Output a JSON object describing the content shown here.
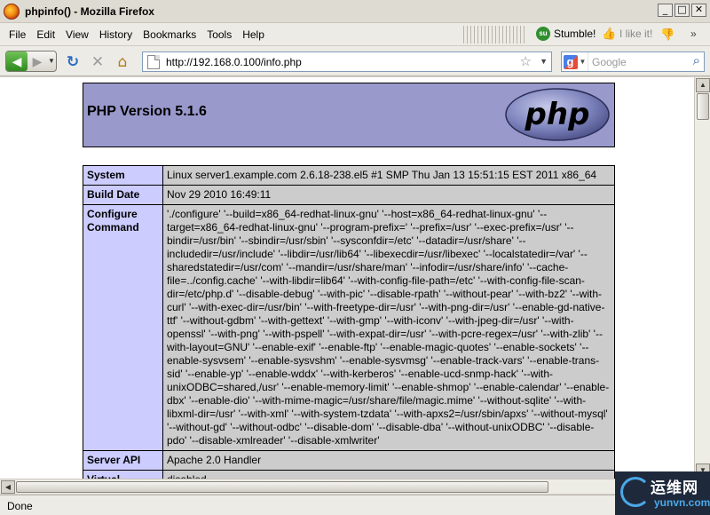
{
  "window": {
    "title": "phpinfo() - Mozilla Firefox",
    "buttons": {
      "minimize": "_",
      "maximize": "□",
      "close": "✕"
    }
  },
  "menu": {
    "items": [
      "File",
      "Edit",
      "View",
      "History",
      "Bookmarks",
      "Tools",
      "Help"
    ],
    "stumble": "Stumble!",
    "like": "I like it!"
  },
  "nav": {
    "url": "http://192.168.0.100/info.php",
    "search_placeholder": "Google"
  },
  "page": {
    "header": "PHP Version 5.1.6",
    "logo_text": "php",
    "rows": [
      {
        "key": "System",
        "value": "Linux server1.example.com 2.6.18-238.el5 #1 SMP Thu Jan 13 15:51:15 EST 2011 x86_64"
      },
      {
        "key": "Build Date",
        "value": "Nov 29 2010 16:49:11"
      },
      {
        "key": "Configure Command",
        "value": "'./configure' '--build=x86_64-redhat-linux-gnu' '--host=x86_64-redhat-linux-gnu' '--target=x86_64-redhat-linux-gnu' '--program-prefix=' '--prefix=/usr' '--exec-prefix=/usr' '--bindir=/usr/bin' '--sbindir=/usr/sbin' '--sysconfdir=/etc' '--datadir=/usr/share' '--includedir=/usr/include' '--libdir=/usr/lib64' '--libexecdir=/usr/libexec' '--localstatedir=/var' '--sharedstatedir=/usr/com' '--mandir=/usr/share/man' '--infodir=/usr/share/info' '--cache-file=../config.cache' '--with-libdir=lib64' '--with-config-file-path=/etc' '--with-config-file-scan-dir=/etc/php.d' '--disable-debug' '--with-pic' '--disable-rpath' '--without-pear' '--with-bz2' '--with-curl' '--with-exec-dir=/usr/bin' '--with-freetype-dir=/usr' '--with-png-dir=/usr' '--enable-gd-native-ttf' '--without-gdbm' '--with-gettext' '--with-gmp' '--with-iconv' '--with-jpeg-dir=/usr' '--with-openssl' '--with-png' '--with-pspell' '--with-expat-dir=/usr' '--with-pcre-regex=/usr' '--with-zlib' '--with-layout=GNU' '--enable-exif' '--enable-ftp' '--enable-magic-quotes' '--enable-sockets' '--enable-sysvsem' '--enable-sysvshm' '--enable-sysvmsg' '--enable-track-vars' '--enable-trans-sid' '--enable-yp' '--enable-wddx' '--with-kerberos' '--enable-ucd-snmp-hack' '--with-unixODBC=shared,/usr' '--enable-memory-limit' '--enable-shmop' '--enable-calendar' '--enable-dbx' '--enable-dio' '--with-mime-magic=/usr/share/file/magic.mime' '--without-sqlite' '--with-libxml-dir=/usr' '--with-xml' '--with-system-tzdata' '--with-apxs2=/usr/sbin/apxs' '--without-mysql' '--without-gd' '--without-odbc' '--disable-dom' '--disable-dba' '--without-unixODBC' '--disable-pdo' '--disable-xmlreader' '--disable-xmlwriter'"
      },
      {
        "key": "Server API",
        "value": "Apache 2.0 Handler"
      },
      {
        "key": "Virtual",
        "value": "disabled"
      }
    ]
  },
  "status": {
    "text": "Done"
  },
  "watermark": {
    "cn": "运维网",
    "en": "yunvn.com"
  },
  "colors": {
    "header_bg": "#9999cc",
    "key_bg": "#ccccff",
    "value_bg": "#cccccc"
  }
}
